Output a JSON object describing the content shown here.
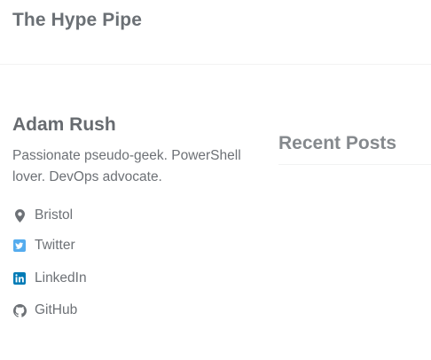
{
  "header": {
    "site_title": "The Hype Pipe"
  },
  "author": {
    "name": "Adam Rush",
    "bio": "Passionate pseudo-geek. PowerShell lover. DevOps advocate.",
    "links": [
      {
        "label": "Bristol",
        "icon": "map-marker-icon",
        "color": "#6d7176"
      },
      {
        "label": "Twitter",
        "icon": "twitter-icon",
        "color": "#55acee"
      },
      {
        "label": "LinkedIn",
        "icon": "linkedin-icon",
        "color": "#007bb6"
      },
      {
        "label": "GitHub",
        "icon": "github-icon",
        "color": "#6d7176"
      }
    ]
  },
  "main": {
    "recent_posts_title": "Recent Posts"
  }
}
